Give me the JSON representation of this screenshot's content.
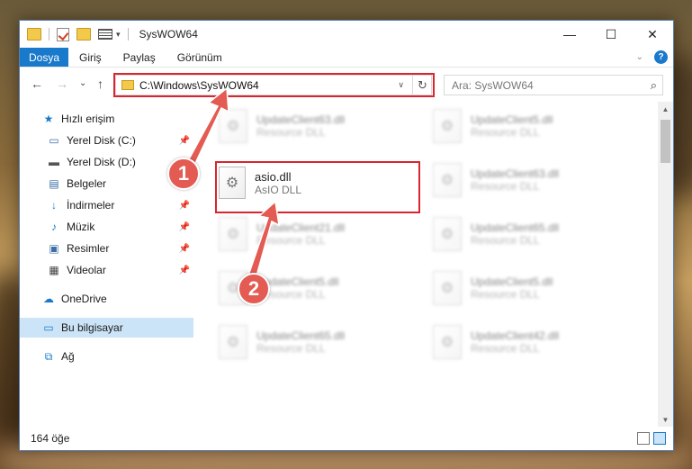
{
  "window": {
    "title": "SysWOW64",
    "controls": [
      "—",
      "☐",
      "✕"
    ]
  },
  "ribbon": {
    "tabs": [
      "Dosya",
      "Giriş",
      "Paylaş",
      "Görünüm"
    ]
  },
  "nav": {
    "back": "←",
    "forward": "→",
    "recent": "⌄",
    "up": "↑"
  },
  "address": {
    "path": "C:\\Windows\\SysWOW64",
    "dropdown": "∨",
    "refresh": "↻"
  },
  "search": {
    "placeholder": "Ara: SysWOW64",
    "icon": "search-icon"
  },
  "sidebar": {
    "items": [
      {
        "label": "Hızlı erişim",
        "icon": "star-icon",
        "pinned": false
      },
      {
        "label": "Yerel Disk (C:)",
        "icon": "drive-icon",
        "pinned": true
      },
      {
        "label": "Yerel Disk (D:)",
        "icon": "drive-icon",
        "pinned": false
      },
      {
        "label": "Belgeler",
        "icon": "documents-icon",
        "pinned": true
      },
      {
        "label": "İndirmeler",
        "icon": "download-icon",
        "pinned": true
      },
      {
        "label": "Müzik",
        "icon": "music-icon",
        "pinned": true
      },
      {
        "label": "Resimler",
        "icon": "pictures-icon",
        "pinned": true
      },
      {
        "label": "Videolar",
        "icon": "video-icon",
        "pinned": true
      },
      {
        "label": "OneDrive",
        "icon": "cloud-icon",
        "pinned": false
      },
      {
        "label": "Bu bilgisayar",
        "icon": "computer-icon",
        "pinned": false
      },
      {
        "label": "Ağ",
        "icon": "network-icon",
        "pinned": false
      }
    ]
  },
  "files": {
    "highlighted": {
      "name": "asio.dll",
      "type": "AsIO DLL"
    },
    "background": [
      {
        "name": "UpdateClient63.dll",
        "type": "Resource DLL"
      },
      {
        "name": "UpdateClient5.dll",
        "type": "Resource DLL"
      },
      {
        "name": "UpdateClient63.dll",
        "type": "Resource DLL"
      },
      {
        "name": "UpdateClient21.dll",
        "type": "Resource DLL"
      },
      {
        "name": "UpdateClient65.dll",
        "type": "Resource DLL"
      },
      {
        "name": "UpdateClient5.dll",
        "type": "Resource DLL"
      },
      {
        "name": "UpdateClient5.dll",
        "type": "Resource DLL"
      },
      {
        "name": "UpdateClient65.dll",
        "type": "Resource DLL"
      },
      {
        "name": "UpdateClient42.dll",
        "type": "Resource DLL"
      }
    ]
  },
  "status": {
    "item_count": "164 öğe"
  },
  "annotations": {
    "step1": "1",
    "step2": "2",
    "color": "#e35b52",
    "box_color": "#d7262f"
  }
}
